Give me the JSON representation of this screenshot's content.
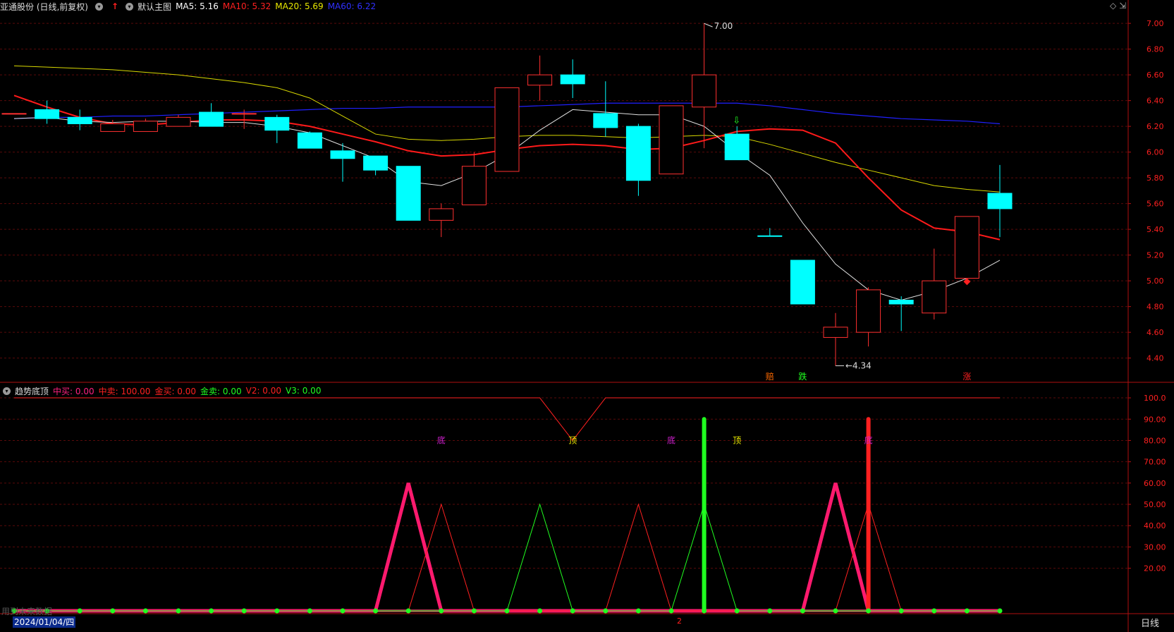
{
  "header": {
    "stock": "亚通股份 (日线,前复权)",
    "template": "默认主图",
    "ma": [
      {
        "label": "MA5: 5.16",
        "color": "#ffffff"
      },
      {
        "label": "MA10: 5.32",
        "color": "#ff2020"
      },
      {
        "label": "MA20: 5.69",
        "color": "#e8e800"
      },
      {
        "label": "MA60: 6.22",
        "color": "#2020ff"
      }
    ]
  },
  "sub_header": {
    "name": "趋势底顶",
    "items": [
      {
        "label": "中买: 0.00",
        "color": "#ff2080"
      },
      {
        "label": "中卖: 100.00",
        "color": "#ff2020"
      },
      {
        "label": "金买: 0.00",
        "color": "#ff2020"
      },
      {
        "label": "金卖: 0.00",
        "color": "#20ff20"
      },
      {
        "label": "V2: 0.00",
        "color": "#ff2020"
      },
      {
        "label": "V3: 0.00",
        "color": "#20ff20"
      }
    ]
  },
  "date_label": "2024/01/04/四",
  "period_label": "日线",
  "bottom_mid_label": "2",
  "ghost_text": "用到未来数据",
  "chart_data": [
    {
      "type": "candlestick",
      "y_ticks": [
        "7.00",
        "6.80",
        "6.60",
        "6.40",
        "6.20",
        "6.00",
        "5.80",
        "5.60",
        "5.40",
        "5.20",
        "5.00",
        "4.80",
        "4.60",
        "4.40"
      ],
      "ylim": [
        4.25,
        7.05
      ],
      "candles": [
        {
          "o": 6.3,
          "c": 6.3,
          "h": 6.3,
          "l": 6.3,
          "up": true
        },
        {
          "o": 6.33,
          "c": 6.26,
          "h": 6.4,
          "l": 6.22,
          "up": false
        },
        {
          "o": 6.27,
          "c": 6.22,
          "h": 6.33,
          "l": 6.17,
          "up": false
        },
        {
          "o": 6.16,
          "c": 6.22,
          "h": 6.25,
          "l": 6.16,
          "up": true
        },
        {
          "o": 6.16,
          "c": 6.24,
          "h": 6.26,
          "l": 6.16,
          "up": true
        },
        {
          "o": 6.2,
          "c": 6.27,
          "h": 6.29,
          "l": 6.2,
          "up": true
        },
        {
          "o": 6.31,
          "c": 6.2,
          "h": 6.38,
          "l": 6.2,
          "up": false
        },
        {
          "o": 6.3,
          "c": 6.3,
          "h": 6.33,
          "l": 6.18,
          "up": true
        },
        {
          "o": 6.27,
          "c": 6.17,
          "h": 6.29,
          "l": 6.07,
          "up": false
        },
        {
          "o": 6.15,
          "c": 6.03,
          "h": 6.16,
          "l": 6.03,
          "up": false
        },
        {
          "o": 6.01,
          "c": 5.95,
          "h": 6.07,
          "l": 5.77,
          "up": false
        },
        {
          "o": 5.97,
          "c": 5.86,
          "h": 5.97,
          "l": 5.82,
          "up": false
        },
        {
          "o": 5.89,
          "c": 5.47,
          "h": 5.89,
          "l": 5.47,
          "up": false
        },
        {
          "o": 5.47,
          "c": 5.56,
          "h": 5.6,
          "l": 5.34,
          "up": true
        },
        {
          "o": 5.59,
          "c": 5.89,
          "h": 6.0,
          "l": 5.59,
          "up": true
        },
        {
          "o": 5.85,
          "c": 6.5,
          "h": 6.5,
          "l": 5.85,
          "up": true
        },
        {
          "o": 6.52,
          "c": 6.6,
          "h": 6.75,
          "l": 6.4,
          "up": true
        },
        {
          "o": 6.6,
          "c": 6.53,
          "h": 6.72,
          "l": 6.42,
          "up": false
        },
        {
          "o": 6.3,
          "c": 6.19,
          "h": 6.55,
          "l": 6.12,
          "up": false
        },
        {
          "o": 6.2,
          "c": 5.78,
          "h": 6.22,
          "l": 5.66,
          "up": false
        },
        {
          "o": 5.83,
          "c": 6.36,
          "h": 6.36,
          "l": 5.83,
          "up": true
        },
        {
          "o": 6.35,
          "c": 6.6,
          "h": 7.0,
          "l": 6.03,
          "up": true
        },
        {
          "o": 6.14,
          "c": 5.94,
          "h": 6.2,
          "l": 5.94,
          "up": false
        },
        {
          "o": 5.35,
          "c": 5.35,
          "h": 5.41,
          "l": 5.35,
          "up": false
        },
        {
          "o": 5.16,
          "c": 4.82,
          "h": 5.16,
          "l": 4.82,
          "up": false
        },
        {
          "o": 4.56,
          "c": 4.64,
          "h": 4.75,
          "l": 4.34,
          "up": true
        },
        {
          "o": 4.6,
          "c": 4.93,
          "h": 4.95,
          "l": 4.49,
          "up": true
        },
        {
          "o": 4.85,
          "c": 4.82,
          "h": 4.88,
          "l": 4.61,
          "up": false
        },
        {
          "o": 4.75,
          "c": 5.0,
          "h": 5.25,
          "l": 4.7,
          "up": true
        },
        {
          "o": 5.02,
          "c": 5.5,
          "h": 5.5,
          "l": 5.0,
          "up": true
        },
        {
          "o": 5.68,
          "c": 5.56,
          "h": 5.9,
          "l": 5.34,
          "up": false
        }
      ],
      "ma5": [
        6.26,
        6.27,
        6.24,
        6.23,
        6.24,
        6.24,
        6.23,
        6.23,
        6.2,
        6.15,
        6.05,
        5.95,
        5.77,
        5.74,
        5.84,
        5.98,
        6.17,
        6.33,
        6.31,
        6.29,
        6.29,
        6.2,
        6.0,
        5.82,
        5.45,
        5.13,
        4.93,
        4.85,
        4.92,
        5.02,
        5.16
      ],
      "ma10": [
        6.44,
        6.35,
        6.27,
        6.22,
        6.21,
        6.23,
        6.25,
        6.25,
        6.24,
        6.2,
        6.14,
        6.08,
        6.01,
        5.97,
        5.98,
        6.02,
        6.05,
        6.06,
        6.05,
        6.02,
        6.03,
        6.09,
        6.16,
        6.18,
        6.17,
        6.07,
        5.8,
        5.55,
        5.41,
        5.38,
        5.32
      ],
      "ma20": [
        6.67,
        6.66,
        6.65,
        6.64,
        6.62,
        6.6,
        6.57,
        6.54,
        6.5,
        6.42,
        6.28,
        6.14,
        6.1,
        6.09,
        6.1,
        6.12,
        6.13,
        6.13,
        6.12,
        6.11,
        6.12,
        6.13,
        6.12,
        6.06,
        5.99,
        5.92,
        5.86,
        5.8,
        5.74,
        5.71,
        5.69
      ],
      "ma60": [
        6.26,
        6.27,
        6.27,
        6.28,
        6.28,
        6.29,
        6.3,
        6.31,
        6.32,
        6.33,
        6.34,
        6.34,
        6.35,
        6.35,
        6.35,
        6.35,
        6.36,
        6.37,
        6.38,
        6.38,
        6.38,
        6.38,
        6.38,
        6.36,
        6.33,
        6.3,
        6.28,
        6.26,
        6.25,
        6.24,
        6.22
      ],
      "annotations": [
        {
          "text": "7.00",
          "index": 21,
          "value": 7.0
        },
        {
          "text": "4.34",
          "index": 25,
          "value": 4.34
        }
      ],
      "signals": [
        {
          "text": "赔",
          "index": 23,
          "color": "#ff6a00"
        },
        {
          "text": "跌",
          "index": 24,
          "color": "#20ff20"
        },
        {
          "text": "涨",
          "index": 29,
          "color": "#ff2020"
        }
      ]
    },
    {
      "type": "line",
      "y_ticks": [
        "100.0",
        "90.00",
        "80.00",
        "70.00",
        "60.00",
        "50.00",
        "40.00",
        "30.00",
        "20.00"
      ],
      "ylim": [
        0,
        103
      ],
      "top_line": [
        100,
        100,
        100,
        100,
        100,
        100,
        100,
        100,
        100,
        100,
        100,
        100,
        100,
        100,
        100,
        100,
        100,
        80,
        100,
        100,
        100,
        100,
        100,
        100,
        100,
        100,
        100,
        100,
        100,
        100,
        100
      ],
      "series": [
        {
          "color": "#ff1a6e",
          "width": 5,
          "values": [
            0,
            0,
            0,
            0,
            0,
            0,
            0,
            0,
            0,
            0,
            0,
            0,
            60,
            0,
            0,
            0,
            0,
            0,
            0,
            0,
            0,
            0,
            0,
            0,
            0,
            60,
            0,
            0,
            0,
            0,
            0
          ]
        },
        {
          "color": "#ff2020",
          "width": 1,
          "values": [
            0,
            0,
            0,
            0,
            0,
            0,
            0,
            0,
            0,
            0,
            0,
            0,
            0,
            50,
            0,
            0,
            0,
            0,
            0,
            50,
            0,
            0,
            0,
            0,
            0,
            0,
            50,
            0,
            0,
            0,
            0
          ]
        },
        {
          "color": "#20ff20",
          "width": 1,
          "values": [
            0,
            0,
            0,
            0,
            0,
            0,
            0,
            0,
            0,
            0,
            0,
            0,
            0,
            0,
            0,
            0,
            50,
            0,
            0,
            0,
            0,
            50,
            0,
            0,
            0,
            0,
            0,
            0,
            0,
            0,
            0
          ]
        }
      ],
      "bars": [
        {
          "index": 21,
          "value": 90,
          "color": "#20ff20"
        },
        {
          "index": 26,
          "value": 90,
          "color": "#ff2020"
        }
      ],
      "labels": [
        {
          "text": "底",
          "index": 13,
          "value": 80,
          "color": "#d020d0"
        },
        {
          "text": "顶",
          "index": 17,
          "value": 80,
          "color": "#e8e800"
        },
        {
          "text": "底",
          "index": 20,
          "value": 80,
          "color": "#d020d0"
        },
        {
          "text": "顶",
          "index": 22,
          "value": 80,
          "color": "#e8e800"
        },
        {
          "text": "底",
          "index": 26,
          "value": 80,
          "color": "#d020d0"
        }
      ]
    }
  ]
}
